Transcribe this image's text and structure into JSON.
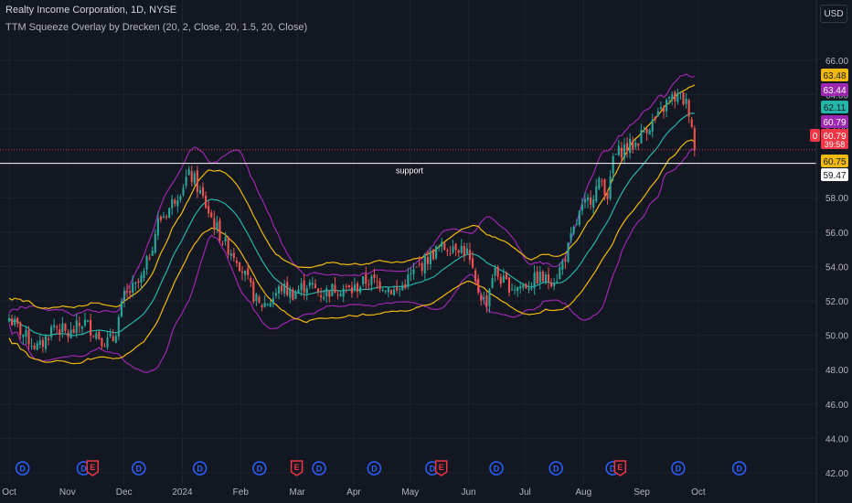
{
  "header": {
    "title": "Realty Income Corporation, 1D, NYSE",
    "indicator": "TTM Squeeze Overlay by Drecken (20, 2, Close, 20, 1.5, 20, Close)"
  },
  "currency": "USD",
  "colors": {
    "background": "#131722",
    "grid": "#1e222d",
    "up": "#26a69a",
    "down": "#ef5350",
    "bollinger": "#9c27b0",
    "keltner": "#f0b90b",
    "basis": "#22b5a8",
    "axis_text": "#b2b5be"
  },
  "chart_data": {
    "type": "candlestick",
    "title": "Realty Income Corporation, 1D, NYSE",
    "ylim": [
      42,
      67
    ],
    "y_ticks": [
      "42.00",
      "44.00",
      "46.00",
      "48.00",
      "50.00",
      "52.00",
      "54.00",
      "56.00",
      "58.00",
      "60.00",
      "62.00",
      "64.00",
      "66.00"
    ],
    "x_ticks": [
      {
        "label": "Oct",
        "t": 0
      },
      {
        "label": "Nov",
        "t": 0.0783
      },
      {
        "label": "Dec",
        "t": 0.1542
      },
      {
        "label": "2024",
        "t": 0.2325
      },
      {
        "label": "Feb",
        "t": 0.3108
      },
      {
        "label": "Mar",
        "t": 0.3867
      },
      {
        "label": "Apr",
        "t": 0.4625
      },
      {
        "label": "May",
        "t": 0.5384
      },
      {
        "label": "Jun",
        "t": 0.6167
      },
      {
        "label": "Jul",
        "t": 0.6925
      },
      {
        "label": "Aug",
        "t": 0.7709
      },
      {
        "label": "Sep",
        "t": 0.8492
      },
      {
        "label": "Oct",
        "t": 0.925
      }
    ],
    "support": {
      "label": "support",
      "value": 60.0
    },
    "current_price_line": 60.79,
    "price_labels": [
      {
        "text": "63.48",
        "value": 63.48,
        "bg": "#f0b90b",
        "fg": "#131722"
      },
      {
        "text": "63.44",
        "value": 63.44,
        "bg": "#9c27b0",
        "fg": "#ffffff"
      },
      {
        "text": "62.11",
        "value": 62.11,
        "bg": "#22b5a8",
        "fg": "#131722"
      },
      {
        "text": "60.79",
        "value": 60.79,
        "bg": "#9c27b0",
        "fg": "#ffffff"
      },
      {
        "text": "60.79",
        "value": 60.79,
        "bg": "#f23645",
        "fg": "#ffffff",
        "sub": "39:58",
        "tag": "0"
      },
      {
        "text": "60.75",
        "value": 60.75,
        "bg": "#f0b90b",
        "fg": "#131722"
      },
      {
        "text": "59.47",
        "value": 59.47,
        "bg": "#ffffff",
        "fg": "#131722"
      }
    ],
    "keyframes": [
      [
        0,
        51.0
      ],
      [
        0.02,
        50.0
      ],
      [
        0.04,
        49.2
      ],
      [
        0.06,
        50.6
      ],
      [
        0.08,
        50.0
      ],
      [
        0.1,
        50.8
      ],
      [
        0.13,
        49.6
      ],
      [
        0.14,
        49.8
      ],
      [
        0.155,
        52.3
      ],
      [
        0.17,
        52.8
      ],
      [
        0.18,
        53.4
      ],
      [
        0.2,
        56.6
      ],
      [
        0.215,
        57.4
      ],
      [
        0.225,
        58.2
      ],
      [
        0.23,
        58.5
      ],
      [
        0.24,
        59.3
      ],
      [
        0.248,
        59.1
      ],
      [
        0.255,
        58.4
      ],
      [
        0.275,
        56.5
      ],
      [
        0.29,
        55.3
      ],
      [
        0.305,
        54.6
      ],
      [
        0.32,
        53.1
      ],
      [
        0.335,
        51.7
      ],
      [
        0.35,
        52.0
      ],
      [
        0.365,
        52.8
      ],
      [
        0.38,
        52.4
      ],
      [
        0.4,
        53.0
      ],
      [
        0.42,
        52.4
      ],
      [
        0.44,
        52.8
      ],
      [
        0.46,
        52.6
      ],
      [
        0.48,
        53.2
      ],
      [
        0.5,
        53.0
      ],
      [
        0.52,
        52.5
      ],
      [
        0.54,
        53.5
      ],
      [
        0.56,
        54.4
      ],
      [
        0.575,
        55.0
      ],
      [
        0.6,
        55.3
      ],
      [
        0.615,
        54.8
      ],
      [
        0.625,
        53.0
      ],
      [
        0.64,
        51.8
      ],
      [
        0.65,
        53.8
      ],
      [
        0.665,
        53.0
      ],
      [
        0.68,
        52.8
      ],
      [
        0.7,
        53.0
      ],
      [
        0.71,
        53.4
      ],
      [
        0.72,
        53.2
      ],
      [
        0.735,
        53.4
      ],
      [
        0.75,
        55.0
      ],
      [
        0.765,
        57.0
      ],
      [
        0.78,
        58.0
      ],
      [
        0.795,
        59.0
      ],
      [
        0.805,
        58.0
      ],
      [
        0.81,
        60.3
      ],
      [
        0.825,
        60.9
      ],
      [
        0.84,
        61.1
      ],
      [
        0.855,
        62.1
      ],
      [
        0.87,
        62.6
      ],
      [
        0.885,
        63.7
      ],
      [
        0.9,
        63.9
      ],
      [
        0.91,
        63.4
      ],
      [
        0.915,
        62.8
      ],
      [
        0.92,
        60.79
      ]
    ],
    "event_markers": [
      {
        "t": 0.018,
        "type": "D"
      },
      {
        "t": 0.1,
        "type": "D"
      },
      {
        "t": 0.112,
        "type": "E"
      },
      {
        "t": 0.174,
        "type": "D"
      },
      {
        "t": 0.256,
        "type": "D"
      },
      {
        "t": 0.336,
        "type": "D"
      },
      {
        "t": 0.386,
        "type": "E"
      },
      {
        "t": 0.416,
        "type": "D"
      },
      {
        "t": 0.49,
        "type": "D"
      },
      {
        "t": 0.568,
        "type": "D"
      },
      {
        "t": 0.58,
        "type": "E"
      },
      {
        "t": 0.654,
        "type": "D"
      },
      {
        "t": 0.734,
        "type": "D"
      },
      {
        "t": 0.81,
        "type": "D"
      },
      {
        "t": 0.82,
        "type": "E"
      },
      {
        "t": 0.898,
        "type": "D"
      },
      {
        "t": 0.98,
        "type": "D"
      }
    ]
  }
}
